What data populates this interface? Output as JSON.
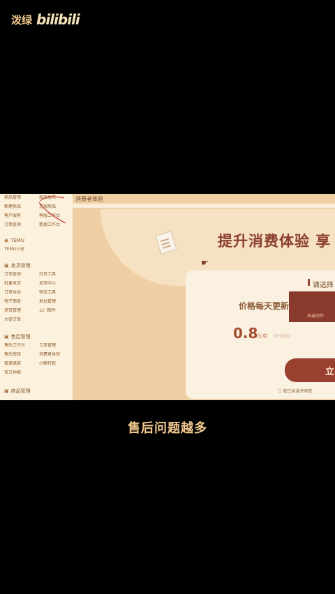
{
  "watermark": {
    "user": "泼绿",
    "logo": "bilibili"
  },
  "sidebar": {
    "top_items": [
      "商品管理",
      "商品发布",
      "新建商品",
      "违规商品",
      "客户服务",
      "客服工作台",
      "订单查询",
      "数据工作台"
    ],
    "temu_label": "TEMU",
    "temu_item": "TEMU入驻",
    "section1_title": "发货管理",
    "section1_items": [
      "订单查询",
      "打单工具",
      "批量发货",
      "发货中心",
      "订单导出",
      "物流工具",
      "电子面单",
      "地址管理",
      "退货管理",
      "上门取件",
      "大促订单"
    ],
    "section2_title": "售后管理",
    "section2_items": [
      "售后工作台",
      "工单管理",
      "售后审核",
      "消费者体验",
      "极速退款",
      "小额打款",
      "官方仲裁"
    ],
    "section3_title": "商品管理"
  },
  "content": {
    "tab_label": "消费者体验",
    "hero_title": "提升消费体验 享",
    "choose_label": "请选择支",
    "price_label": "价格每天更新",
    "dark_tile_text": "未选动作",
    "price_value": "0.8",
    "price_unit": "元/单",
    "price_extra": "(0.95起)",
    "cta_label": "立",
    "agree_text": "我已阅读并同意"
  },
  "subtitle": "售后问题越多"
}
